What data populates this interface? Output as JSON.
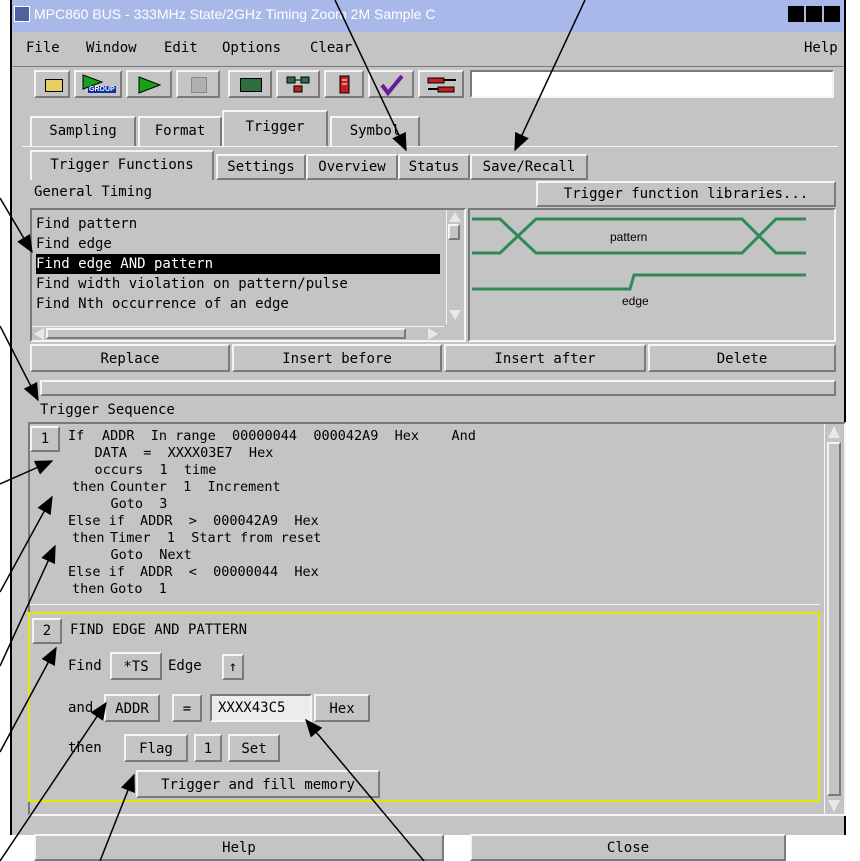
{
  "window": {
    "title": "MPC860 BUS - 333MHz State/2GHz Timing Zoom 2M Sample C"
  },
  "menubar": {
    "file": "File",
    "window": "Window",
    "edit": "Edit",
    "options": "Options",
    "clear": "Clear",
    "help": "Help"
  },
  "toolbar": {
    "group_label": "GROUP"
  },
  "tabs": {
    "sampling": "Sampling",
    "format": "Format",
    "trigger": "Trigger",
    "symbol": "Symbol"
  },
  "subtabs": {
    "functions": "Trigger Functions",
    "settings": "Settings",
    "overview": "Overview",
    "status": "Status",
    "save_recall": "Save/Recall"
  },
  "functions": {
    "category": "General Timing",
    "libraries_button": "Trigger function libraries...",
    "list": [
      "Find pattern",
      "Find edge",
      "Find edge AND pattern",
      "Find width violation on pattern/pulse",
      "Find Nth occurrence of an edge"
    ],
    "selected_index": 2,
    "preview": {
      "pattern_label": "pattern",
      "edge_label": "edge"
    },
    "colors": {
      "waveform": "#2e8b57",
      "selection_bg": "#000000",
      "selection_fg": "#ffffff"
    }
  },
  "actions": {
    "replace": "Replace",
    "insert_before": "Insert before",
    "insert_after": "Insert after",
    "delete": "Delete"
  },
  "sequence": {
    "title": "Trigger Sequence",
    "step1": {
      "number": "1",
      "lines": [
        [
          "If",
          "ADDR  In range  00000044  000042A9  Hex    And"
        ],
        [
          "",
          "    DATA  =  XXXX03E7  Hex"
        ],
        [
          "",
          "    occurs  1  time"
        ],
        [
          "then",
          "Counter  1  Increment"
        ],
        [
          "",
          "    Goto  3"
        ],
        [
          "Else if",
          "ADDR  >  000042A9  Hex"
        ],
        [
          "then",
          "Timer  1  Start from reset"
        ],
        [
          "",
          "    Goto  Next"
        ],
        [
          "Else if",
          "ADDR  <  00000044  Hex"
        ],
        [
          "then",
          "Goto  1"
        ]
      ]
    },
    "step2": {
      "number": "2",
      "title": "FIND EDGE AND PATTERN",
      "find_label": "Find",
      "signal": "*TS",
      "edge_label": "Edge",
      "edge_symbol": "↑",
      "and_label": "and",
      "bus": "ADDR",
      "operator": "=",
      "value": "XXXX43C5",
      "base": "Hex",
      "then_label": "then",
      "flag_label": "Flag",
      "flag_number": "1",
      "flag_action": "Set",
      "final_action": "Trigger and fill memory",
      "border_color": "#e6e600"
    }
  },
  "footer": {
    "help": "Help",
    "close": "Close"
  },
  "colors": {
    "titlebar": "#a8b8e8",
    "titlebar_text": "#ffffff",
    "panel": "#c4c4c4",
    "checkmark": "#6a1b9a",
    "play": "#18a018"
  }
}
